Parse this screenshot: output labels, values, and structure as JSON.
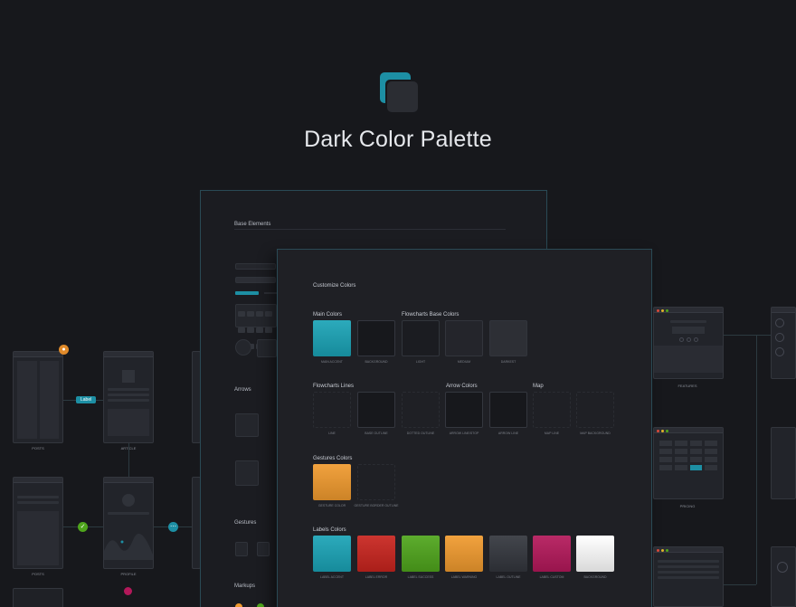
{
  "header": {
    "title": "Dark Color Palette"
  },
  "colors": {
    "background": "#17181c",
    "accent": "#1d8fa4",
    "artboard": "#1f2025"
  },
  "back_board": {
    "sections": [
      "Base Elements",
      "Arrows",
      "Gestures",
      "Markups"
    ]
  },
  "front_board": {
    "title": "Customize Colors",
    "groups": {
      "main_colors": "Main Colors",
      "flowcharts_base": "Flowcharts Base Colors",
      "flowcharts_lines": "Flowcharts Lines",
      "arrow_colors": "Arrow Colors",
      "map": "Map",
      "gestures_colors": "Gestures Colors",
      "labels_colors": "Labels Colors"
    },
    "row1": [
      {
        "caption": "MAIN ACCENT",
        "color": "#1aa3b6"
      },
      {
        "caption": "BACKGROUND",
        "color": "#17181c"
      },
      {
        "caption": "LIGHT",
        "color": "#1b1c21"
      },
      {
        "caption": "MEDIUM",
        "color": "#24252b"
      },
      {
        "caption": "DARKEST",
        "color": "#2d2f35"
      }
    ],
    "row2": [
      {
        "caption": "LINE",
        "color": ""
      },
      {
        "caption": "BASE OUTLINE",
        "color": ""
      },
      {
        "caption": "DOTTED OUTLINE",
        "color": ""
      },
      {
        "caption": "ARROW LINE/STOP",
        "color": ""
      },
      {
        "caption": "ARROW LINE",
        "color": ""
      },
      {
        "caption": "MAP LINE",
        "color": ""
      },
      {
        "caption": "MAP BACKGROUND",
        "color": ""
      }
    ],
    "row3": [
      {
        "caption": "GESTURE COLOR",
        "color": "#f09a2e"
      },
      {
        "caption": "GESTURE BORDER OUTLINE",
        "color": ""
      }
    ],
    "row4": [
      {
        "caption": "LABEL ACCENT",
        "color": "#1aa3b6"
      },
      {
        "caption": "LABEL ERROR",
        "color": "#c8241e"
      },
      {
        "caption": "LABEL SUCCESS",
        "color": "#4fa51c"
      },
      {
        "caption": "LABEL WARNING",
        "color": "#f09a2e"
      },
      {
        "caption": "LABEL OUTLINE",
        "color": "#33363d"
      },
      {
        "caption": "LABEL CUSTOM",
        "color": "#b3185a"
      },
      {
        "caption": "BACKGROUND",
        "color": "#ffffff"
      }
    ]
  },
  "left_screens": {
    "captions": [
      "POSTS",
      "ARTICLE",
      "POSTS",
      "PROFILE"
    ],
    "label_chip": "Label"
  },
  "right_screens": {
    "captions": [
      "FEATURES",
      "PRICING"
    ]
  }
}
